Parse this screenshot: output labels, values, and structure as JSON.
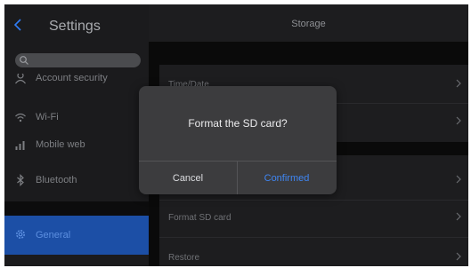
{
  "sidebar": {
    "title": "Settings",
    "back_icon": "chevron-left-icon",
    "search_icon": "search-icon",
    "items": [
      {
        "label": "Account security",
        "icon": "account-icon"
      },
      {
        "label": "Wi-Fi",
        "icon": "wifi-icon"
      },
      {
        "label": "Mobile web",
        "icon": "signal-bars-icon"
      },
      {
        "label": "Bluetooth",
        "icon": "bluetooth-icon"
      },
      {
        "label": "General",
        "icon": "gear-icon",
        "active": true
      }
    ]
  },
  "main": {
    "title": "Storage",
    "rows": [
      {
        "label": "Time/Date"
      },
      {
        "label": ""
      },
      {
        "label": ""
      },
      {
        "label": "Format SD card"
      },
      {
        "label": "Restore"
      }
    ]
  },
  "dialog": {
    "message": "Format the SD card?",
    "cancel_label": "Cancel",
    "confirm_label": "Confirmed"
  },
  "colors": {
    "accent": "#2f7cf6",
    "sidebar_active_bg": "#1c4fa6",
    "dialog_bg": "#3c3c3e",
    "background": "#0a0a0a"
  }
}
